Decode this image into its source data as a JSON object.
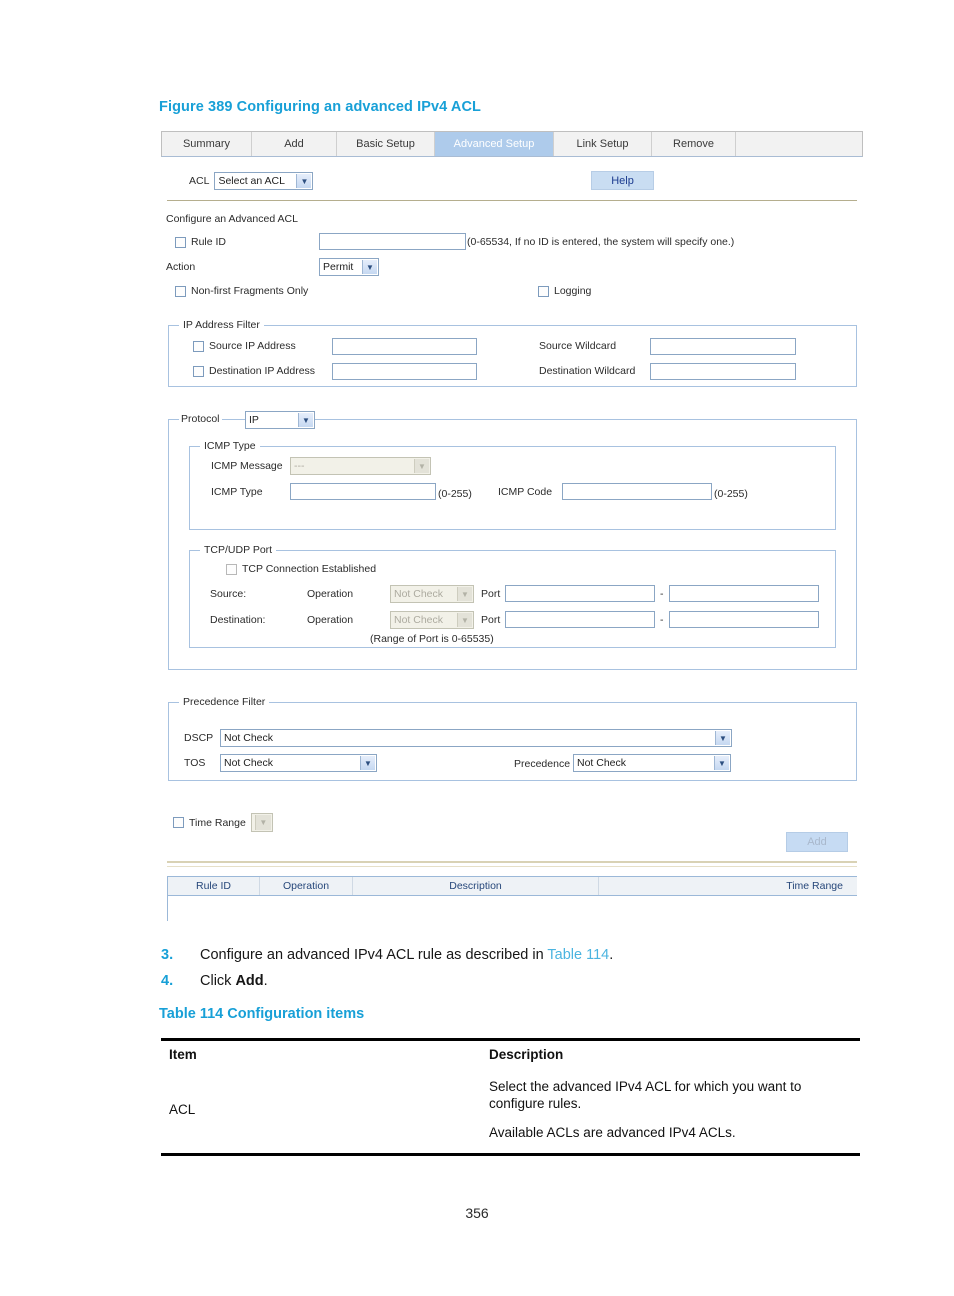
{
  "document": {
    "figure_caption": "Figure 389 Configuring an advanced IPv4 ACL",
    "table_caption": "Table 114 Configuration items",
    "page_number": "356"
  },
  "steps": [
    {
      "num": "3.",
      "text_before": "Configure an advanced IPv4 ACL rule as described in ",
      "xref": "Table 114",
      "text_after": "."
    },
    {
      "num": "4.",
      "text_before": "Click ",
      "bold": "Add",
      "text_after": "."
    }
  ],
  "ui": {
    "tabs": [
      {
        "label": "Summary",
        "active": false
      },
      {
        "label": "Add",
        "active": false
      },
      {
        "label": "Basic Setup",
        "active": false
      },
      {
        "label": "Advanced Setup",
        "active": true
      },
      {
        "label": "Link Setup",
        "active": false
      },
      {
        "label": "Remove",
        "active": false
      }
    ],
    "acl_label": "ACL",
    "acl_select_value": "Select an ACL",
    "help_button": "Help",
    "section_title": "Configure an Advanced ACL",
    "rule_id": {
      "checkbox_label": "Rule ID",
      "value": "",
      "hint": "(0-65534, If no ID is entered, the system will specify one.)"
    },
    "action": {
      "label": "Action",
      "value": "Permit"
    },
    "non_first_fragments_label": "Non-first Fragments Only",
    "logging_label": "Logging",
    "ip_address_filter": {
      "legend": "IP Address Filter",
      "source_ip_label": "Source IP Address",
      "source_ip_value": "",
      "source_wildcard_label": "Source Wildcard",
      "source_wildcard_value": "",
      "dest_ip_label": "Destination IP Address",
      "dest_ip_value": "",
      "dest_wildcard_label": "Destination Wildcard",
      "dest_wildcard_value": ""
    },
    "protocol": {
      "label": "Protocol",
      "value": "IP"
    },
    "icmp": {
      "legend": "ICMP Type",
      "message_label": "ICMP Message",
      "message_value": "---",
      "type_label": "ICMP Type",
      "type_value": "",
      "type_hint": "(0-255)",
      "code_label": "ICMP Code",
      "code_value": "",
      "code_hint": "(0-255)"
    },
    "tcpudp": {
      "legend": "TCP/UDP Port",
      "established_label": "TCP Connection Established",
      "source_label": "Source:",
      "destination_label": "Destination:",
      "operation_label": "Operation",
      "operation_value": "Not Check",
      "port_label": "Port",
      "port_from": "",
      "port_to": "",
      "range_separator": "-",
      "range_hint": "(Range of Port is 0-65535)"
    },
    "precedence_filter": {
      "legend": "Precedence Filter",
      "dscp_label": "DSCP",
      "dscp_value": "Not Check",
      "tos_label": "TOS",
      "tos_value": "Not Check",
      "precedence_label": "Precedence",
      "precedence_value": "Not Check"
    },
    "time_range": {
      "label": "Time Range",
      "value": ""
    },
    "add_button": "Add",
    "results_table": {
      "headers": [
        "Rule ID",
        "Operation",
        "Description",
        "Time Range"
      ],
      "rows": []
    }
  },
  "config_table": {
    "headers": [
      "Item",
      "Description"
    ],
    "rows": [
      {
        "item": "ACL",
        "desc_1": "Select the advanced IPv4 ACL for which you want to configure rules.",
        "desc_2": "Available ACLs are advanced IPv4 ACLs."
      }
    ]
  },
  "colors": {
    "heading_blue": "#18a0d7",
    "link_blue": "#4bb4e0",
    "tab_active_bg": "#aecbeb",
    "group_border": "#a8c2e0",
    "button_blue": "#c9ddf2"
  }
}
